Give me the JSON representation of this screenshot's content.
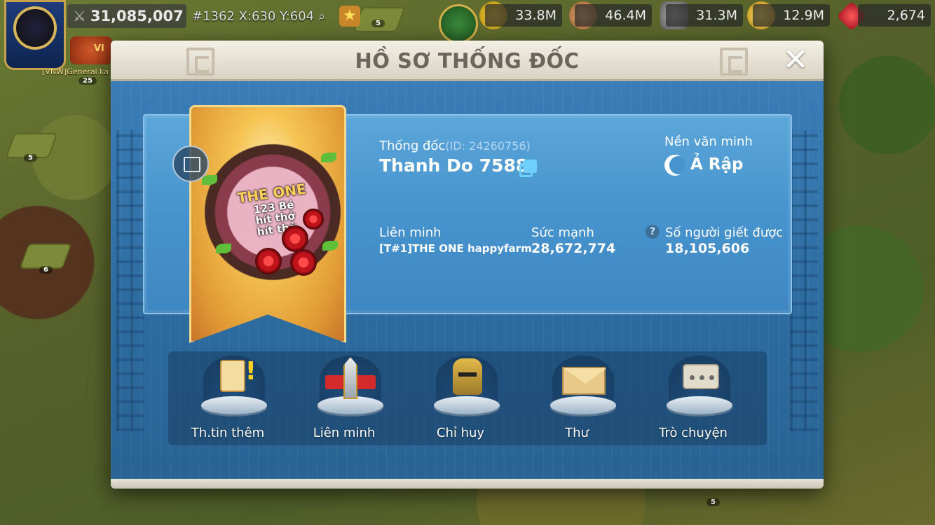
{
  "hud": {
    "power": "31,085,007",
    "location": "#1362 X:630 Y:604",
    "vip_label": "VI",
    "alliance_tag": "[VNW]General ka",
    "level": "25",
    "resources": [
      {
        "icon": "corn-icon",
        "value": "33.8M"
      },
      {
        "icon": "wood-icon",
        "value": "46.4M"
      },
      {
        "icon": "stone-icon",
        "value": "31.3M"
      },
      {
        "icon": "gold-icon",
        "value": "12.9M"
      },
      {
        "icon": "gem-icon",
        "value": "2,674"
      }
    ]
  },
  "map": {
    "tags": [
      "5",
      "6",
      "5",
      "5"
    ]
  },
  "dialog": {
    "title": "HỒ SƠ THỐNG ĐỐC",
    "governor_label": "Thống đốc",
    "governor_id": "(ID: 24260756)",
    "governor_name": "Thanh Do 7588",
    "civ_label": "Nền văn minh",
    "civ_value": "Ả Rập",
    "alliance_label": "Liên minh",
    "alliance_value": "[T#1]THE ONE happyfarm",
    "power_label": "Sức mạnh",
    "power_value": "28,672,774",
    "kills_label": "Số người giết được",
    "kills_value": "18,105,606",
    "emblem": {
      "line1": "THE ONE",
      "line2": "123 Bé",
      "line3": "hít thở",
      "line4": "hít thở"
    },
    "actions": [
      {
        "label": "Th.tin thêm"
      },
      {
        "label": "Liên minh"
      },
      {
        "label": "Chỉ huy"
      },
      {
        "label": "Thư"
      },
      {
        "label": "Trò chuyện"
      }
    ]
  },
  "colors": {
    "title_text": "#6b655b",
    "panel_blue": "#4693cd",
    "copy_accent": "#6ed0ff"
  }
}
